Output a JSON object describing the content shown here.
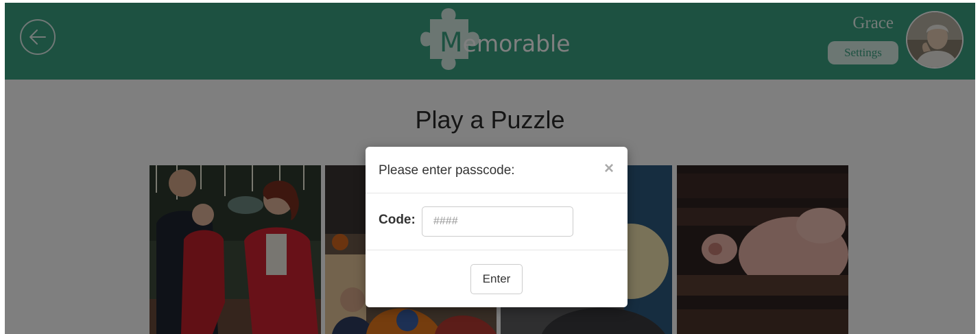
{
  "header": {
    "back_icon": "arrow-left-icon",
    "logo": {
      "text_initial": "M",
      "text_rest": "emorable",
      "icon": "puzzle-piece-icon"
    },
    "user": {
      "name": "Grace",
      "settings_label": "Settings",
      "avatar_icon": "user-avatar"
    }
  },
  "main": {
    "title": "Play a Puzzle",
    "photos": [
      {
        "name": "family-photo"
      },
      {
        "name": "children-photo"
      },
      {
        "name": "woman-photo"
      },
      {
        "name": "pig-photo"
      }
    ]
  },
  "modal": {
    "title": "Please enter passcode:",
    "close_label": "×",
    "code_label": "Code:",
    "code_placeholder": "####",
    "code_value": "",
    "enter_label": "Enter"
  },
  "colors": {
    "header_bg": "#3aa283",
    "overlay": "rgba(0,0,0,0.5)",
    "modal_bg": "#ffffff"
  }
}
